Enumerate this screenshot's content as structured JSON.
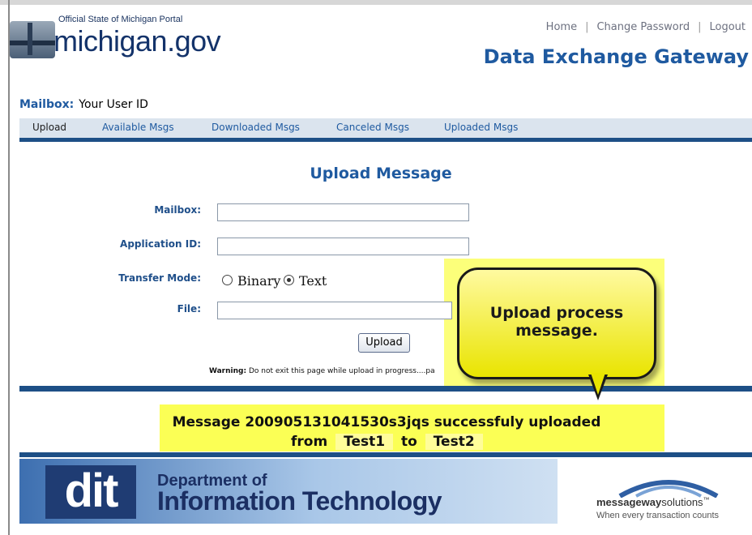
{
  "header": {
    "portal_label": "Official State of Michigan Portal",
    "logo_text": "michigan.gov",
    "links": [
      "Home",
      "Change Password",
      "Logout"
    ],
    "app_title": "Data Exchange Gateway"
  },
  "mailbox_bar": {
    "label": "Mailbox:",
    "value": "Your User ID"
  },
  "tabs": [
    {
      "label": "Upload",
      "active": true
    },
    {
      "label": "Available Msgs"
    },
    {
      "label": "Downloaded Msgs"
    },
    {
      "label": "Canceled Msgs"
    },
    {
      "label": "Uploaded Msgs"
    }
  ],
  "form": {
    "title": "Upload Message",
    "mailbox_label": "Mailbox:",
    "mailbox_value": "",
    "app_id_label": "Application ID:",
    "app_id_value": "",
    "transfer_label": "Transfer Mode:",
    "transfer_options": [
      "Binary",
      "Text"
    ],
    "transfer_selected": "Text",
    "file_label": "File:",
    "file_value": "",
    "upload_button": "Upload",
    "warning_bold": "Warning:",
    "warning_text": "Do not exit this page while upload in progress....pa"
  },
  "callout": {
    "text": "Upload process message."
  },
  "result": {
    "line1": "Message 200905131041530s3jqs successfuly uploaded",
    "from_word": "from",
    "from_value": "Test1",
    "to_word": "to",
    "to_value": "Test2"
  },
  "footer": {
    "dept_logo": "dit",
    "dept_line1": "Department of",
    "dept_line2": "Information Technology",
    "vendor_name_bold": "messageway",
    "vendor_name_rest": "solutions",
    "vendor_tm": "™",
    "vendor_tagline": "When every transaction counts"
  },
  "colors": {
    "accent": "#1f5aa0",
    "navy": "#1d4f86",
    "highlight": "#fbff55"
  }
}
